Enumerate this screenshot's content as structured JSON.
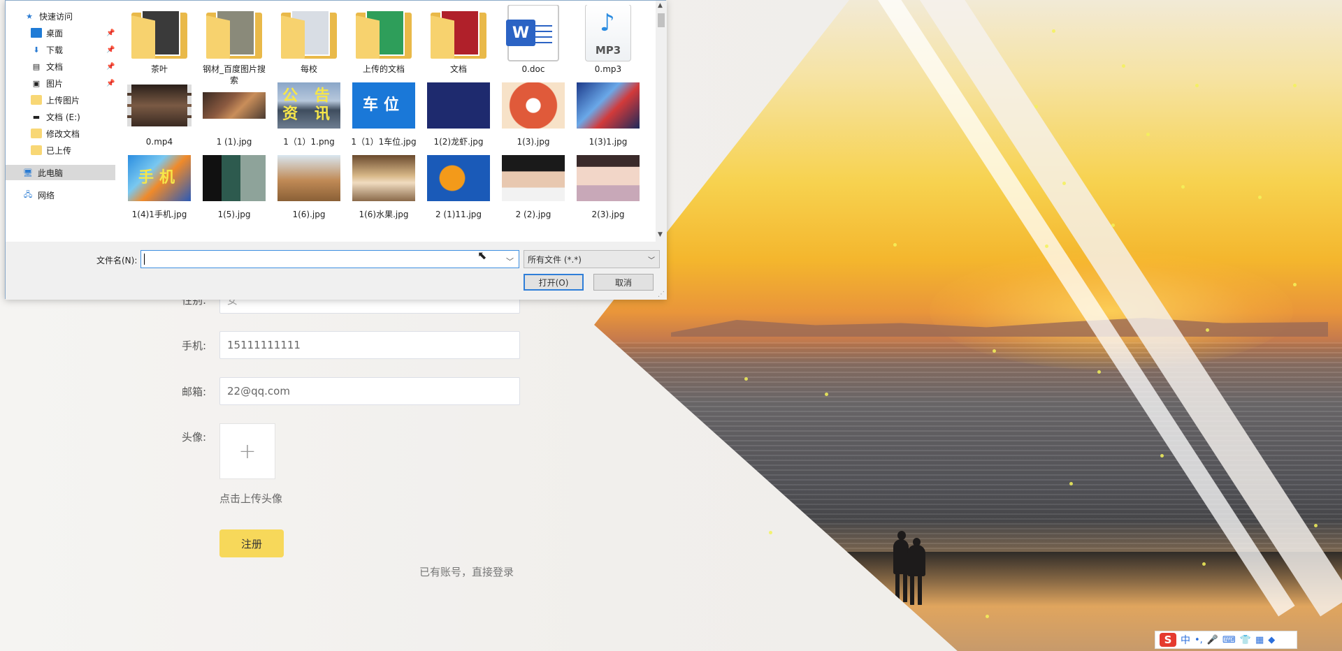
{
  "form": {
    "gender_label": "性别:",
    "gender_value": "女",
    "phone_label": "手机:",
    "phone_value": "15111111111",
    "email_label": "邮箱:",
    "email_value": "22@qq.com",
    "avatar_label": "头像:",
    "upload_plus": "+",
    "upload_hint": "点击上传头像",
    "register_label": "注册",
    "login_link": "已有账号，直接登录"
  },
  "dialog": {
    "nav": [
      {
        "label": "快速访问",
        "icon": "star-icon"
      },
      {
        "label": "桌面",
        "icon": "desktop-icon",
        "pinned": true
      },
      {
        "label": "下载",
        "icon": "download-icon",
        "pinned": true
      },
      {
        "label": "文档",
        "icon": "document-icon",
        "pinned": true
      },
      {
        "label": "图片",
        "icon": "pictures-icon",
        "pinned": true
      },
      {
        "label": "上传图片",
        "icon": "folder-icon"
      },
      {
        "label": "文档 (E:)",
        "icon": "drive-icon"
      },
      {
        "label": "修改文档",
        "icon": "folder-icon"
      },
      {
        "label": "已上传",
        "icon": "folder-icon"
      },
      {
        "label": "此电脑",
        "icon": "computer-icon",
        "selected": true
      },
      {
        "label": "网络",
        "icon": "network-icon"
      }
    ],
    "files": [
      {
        "name": "茶叶",
        "type": "folder"
      },
      {
        "name": "钢材_百度图片搜索",
        "type": "folder"
      },
      {
        "name": "每校",
        "type": "folder"
      },
      {
        "name": "上传的文档",
        "type": "folder"
      },
      {
        "name": "文档",
        "type": "folder"
      },
      {
        "name": "0.doc",
        "type": "doc"
      },
      {
        "name": "0.mp3",
        "type": "mp3"
      },
      {
        "name": "0.mp4",
        "type": "video"
      },
      {
        "name": "1 (1).jpg",
        "type": "image"
      },
      {
        "name": "1（1）1.png",
        "type": "image",
        "text": "公 告\n资 讯"
      },
      {
        "name": "1（1）1车位.jpg",
        "type": "image",
        "text": "车位"
      },
      {
        "name": "1(2)龙虾.jpg",
        "type": "image"
      },
      {
        "name": "1(3).jpg",
        "type": "image"
      },
      {
        "name": "1(3)1.jpg",
        "type": "image"
      },
      {
        "name": "1(4)1手机.jpg",
        "type": "image",
        "text": "手机"
      },
      {
        "name": "1(5).jpg",
        "type": "image"
      },
      {
        "name": "1(6).jpg",
        "type": "image"
      },
      {
        "name": "1(6)水果.jpg",
        "type": "image"
      },
      {
        "name": "2 (1)11.jpg",
        "type": "image"
      },
      {
        "name": "2 (2).jpg",
        "type": "image"
      },
      {
        "name": "2(3).jpg",
        "type": "image"
      }
    ],
    "filename_label": "文件名(N):",
    "filename_value": "",
    "filetype_value": "所有文件 (*.*)",
    "open_label": "打开(O)",
    "cancel_label": "取消"
  },
  "ime": {
    "logo": "S",
    "mode": "中",
    "punct": "•,"
  },
  "colors": {
    "accent": "#f7d85a",
    "dialog_border": "#8aa9c8",
    "selected_nav": "#d9d9d9"
  }
}
